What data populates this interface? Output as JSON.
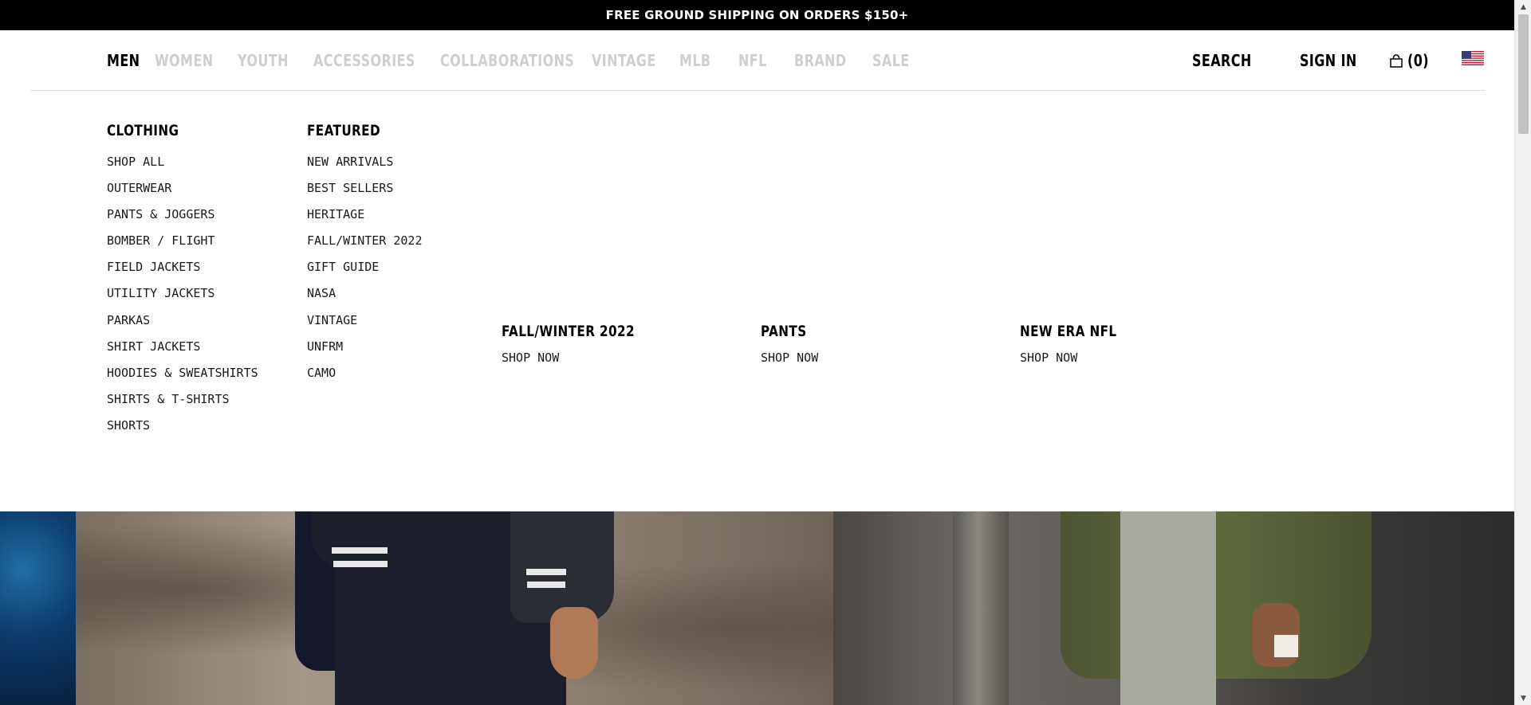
{
  "promo_bar": {
    "text": "FREE GROUND SHIPPING ON ORDERS $150+"
  },
  "nav": {
    "items": [
      {
        "label": "MEN",
        "active": true
      },
      {
        "label": "WOMEN",
        "active": false
      },
      {
        "label": "YOUTH",
        "active": false
      },
      {
        "label": "ACCESSORIES",
        "active": false
      },
      {
        "label": "COLLABORATIONS",
        "active": false
      },
      {
        "label": "VINTAGE",
        "active": false
      },
      {
        "label": "MLB",
        "active": false
      },
      {
        "label": "NFL",
        "active": false
      },
      {
        "label": "BRAND",
        "active": false
      },
      {
        "label": "SALE",
        "active": false
      }
    ],
    "search_label": "SEARCH",
    "signin_label": "SIGN IN",
    "bag_label": "(0)",
    "flag_icon": "us-flag-icon"
  },
  "mega_menu": {
    "clothing": {
      "heading": "CLOTHING",
      "links": [
        "SHOP ALL",
        "OUTERWEAR",
        "PANTS & JOGGERS",
        "BOMBER / FLIGHT",
        "FIELD JACKETS",
        "UTILITY JACKETS",
        "PARKAS",
        "SHIRT JACKETS",
        "HOODIES & SWEATSHIRTS",
        "SHIRTS & T-SHIRTS",
        "SHORTS"
      ]
    },
    "featured": {
      "heading": "FEATURED",
      "links": [
        "NEW ARRIVALS",
        "BEST SELLERS",
        "HERITAGE",
        "FALL/WINTER 2022",
        "GIFT GUIDE",
        "NASA",
        "VINTAGE",
        "UNFRM",
        "CAMO"
      ]
    },
    "promos": [
      {
        "title": "FALL/WINTER 2022",
        "cta": "SHOP NOW"
      },
      {
        "title": "PANTS",
        "cta": "SHOP NOW"
      },
      {
        "title": "NEW ERA NFL",
        "cta": "SHOP NOW"
      }
    ]
  },
  "colors": {
    "promo_bg": "#000000",
    "nav_inactive": "#cfcfcf",
    "nav_active": "#000000"
  }
}
